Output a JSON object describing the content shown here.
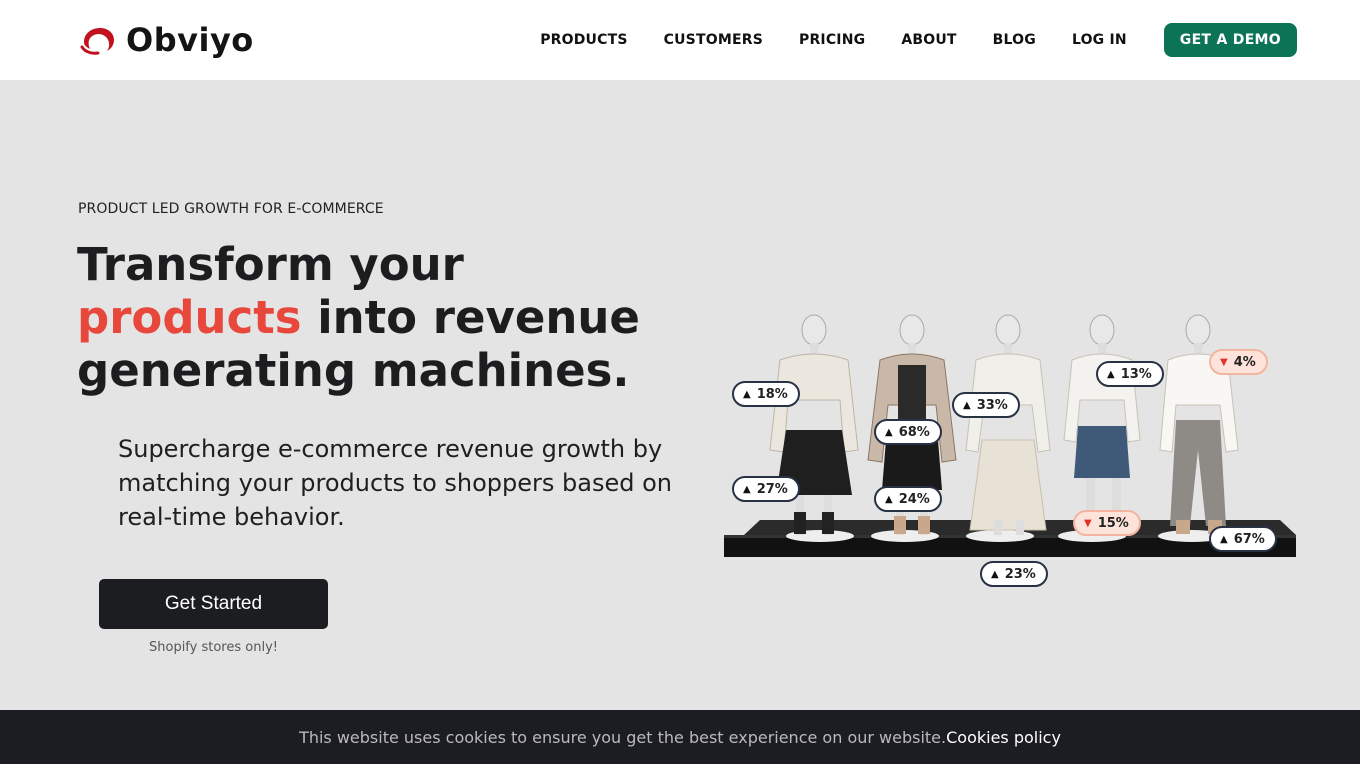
{
  "brand": {
    "name": "Obviyo",
    "logo_icon": "swoosh-logo-icon",
    "accent_color": "#c1121f"
  },
  "nav": {
    "items": [
      "PRODUCTS",
      "CUSTOMERS",
      "PRICING",
      "ABOUT",
      "BLOG",
      "LOG IN"
    ],
    "cta_label": "GET A DEMO",
    "cta_color": "#0b7356"
  },
  "hero": {
    "eyebrow": "PRODUCT LED GROWTH FOR E-COMMERCE",
    "headline_line1": "Transform your",
    "headline_accent": "products",
    "headline_rest": " into revenue",
    "headline_line3": "generating machines.",
    "subtext": "Supercharge e-commerce revenue growth by matching your products to shoppers based on real-time behavior.",
    "cta_label": "Get Started",
    "cta_note": "Shopify stores only!"
  },
  "illustration": {
    "icon": "mannequins-display-illustration",
    "badges": [
      {
        "label": "18%",
        "direction": "up"
      },
      {
        "label": "27%",
        "direction": "up"
      },
      {
        "label": "68%",
        "direction": "up"
      },
      {
        "label": "24%",
        "direction": "up"
      },
      {
        "label": "33%",
        "direction": "up"
      },
      {
        "label": "23%",
        "direction": "up"
      },
      {
        "label": "13%",
        "direction": "up"
      },
      {
        "label": "15%",
        "direction": "down"
      },
      {
        "label": "4%",
        "direction": "down"
      },
      {
        "label": "67%",
        "direction": "up"
      }
    ]
  },
  "cookie_bar": {
    "text": "This website uses cookies to ensure you get the best experience on our website.",
    "link": "Cookies policy"
  }
}
